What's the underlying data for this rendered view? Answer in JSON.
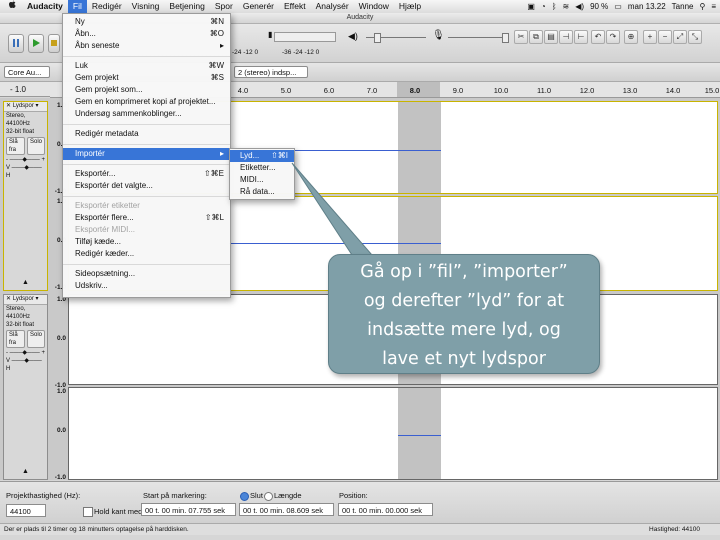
{
  "menubar": {
    "app_name": "Audacity",
    "items": [
      "Fil",
      "Redigér",
      "Visning",
      "Betjening",
      "Spor",
      "Generér",
      "Effekt",
      "Analysér",
      "Window",
      "Hjælp"
    ],
    "battery": "90 %",
    "clock": "man 13.22",
    "user": "Tanne"
  },
  "window": {
    "title": "Audacity"
  },
  "toolbar": {
    "meter_ticks": [
      "-24",
      "-12",
      "0",
      "-36",
      "-24",
      "-12",
      "0"
    ]
  },
  "devices": {
    "host": "Core Au...",
    "channels": "2 (stereo) indsp..."
  },
  "ruler": {
    "left_label": "- 1.0",
    "ticks": [
      "4.0",
      "5.0",
      "6.0",
      "7.0",
      "8.0",
      "9.0",
      "10.0",
      "11.0",
      "12.0",
      "13.0",
      "14.0",
      "15.0"
    ]
  },
  "tracks": [
    {
      "name": "Lydspor",
      "info1": "Stereo, 44100Hz",
      "info2": "32-bit float",
      "mute": "Slå fra",
      "solo": "Solo",
      "gain_minus": "-",
      "gain_plus": "+",
      "pan_left": "V",
      "pan_right": "H",
      "scale_top": [
        "1.0",
        "0.0",
        "-1.0"
      ],
      "scale_bottom": [
        "1.0",
        "0.0",
        "-1.0"
      ]
    },
    {
      "name": "Lydspor",
      "info1": "Stereo, 44100Hz",
      "info2": "32-bit float",
      "mute": "Slå fra",
      "solo": "Solo",
      "gain_minus": "-",
      "gain_plus": "+",
      "pan_left": "V",
      "pan_right": "H",
      "scale_top": [
        "1.0",
        "0.0",
        "-1.0"
      ],
      "scale_bottom": [
        "1.0",
        "0.0",
        "-1.0"
      ]
    }
  ],
  "file_menu": {
    "items": [
      {
        "label": "Ny",
        "shortcut": "⌘N"
      },
      {
        "label": "Åbn...",
        "shortcut": "⌘O"
      },
      {
        "label": "Åbn seneste",
        "shortcut": "▸"
      },
      {
        "label": "Luk",
        "shortcut": "⌘W"
      },
      {
        "label": "Gem projekt",
        "shortcut": "⌘S"
      },
      {
        "label": "Gem projekt som...",
        "shortcut": ""
      },
      {
        "label": "Gem en komprimeret kopi af projektet...",
        "shortcut": ""
      },
      {
        "label": "Undersøg sammenkoblinger...",
        "shortcut": ""
      },
      {
        "label": "Redigér metadata",
        "shortcut": ""
      },
      {
        "label": "Importér",
        "shortcut": "▸"
      },
      {
        "label": "Eksportér...",
        "shortcut": "⇧⌘E"
      },
      {
        "label": "Eksportér det valgte...",
        "shortcut": ""
      },
      {
        "label": "Eksportér etiketter",
        "shortcut": ""
      },
      {
        "label": "Eksportér flere...",
        "shortcut": "⇧⌘L"
      },
      {
        "label": "Eksportér MIDI...",
        "shortcut": ""
      },
      {
        "label": "Tilføj kæde...",
        "shortcut": ""
      },
      {
        "label": "Redigér kæder...",
        "shortcut": ""
      },
      {
        "label": "Sideopsætning...",
        "shortcut": ""
      },
      {
        "label": "Udskriv...",
        "shortcut": ""
      }
    ]
  },
  "import_submenu": {
    "items": [
      {
        "label": "Lyd...",
        "shortcut": "⇧⌘I"
      },
      {
        "label": "Etiketter...",
        "shortcut": ""
      },
      {
        "label": "MIDI...",
        "shortcut": ""
      },
      {
        "label": "Rå data...",
        "shortcut": ""
      }
    ]
  },
  "callout": {
    "lines": [
      "Gå op i ”fil”, ”importer”",
      "og derefter ”lyd” for at",
      "indsætte mere lyd, og",
      "lave et nyt lydspor"
    ]
  },
  "selection_bar": {
    "rate_label": "Projekthastighed (Hz):",
    "rate_value": "44100",
    "snap_label": "Hold kant med",
    "start_label": "Start på markering:",
    "end_radio": "Slut",
    "length_radio": "Længde",
    "position_label": "Position:",
    "start_value": "00 t. 00 min. 07.755 sek",
    "end_value": "00 t. 00 min. 08.609 sek",
    "position_value": "00 t. 00 min. 00.000 sek"
  },
  "status_bar": {
    "left": "Der er plads til 2 timer og 18 minutters optagelse på harddisken.",
    "right": "Hastighed: 44100"
  },
  "colors": {
    "menu_highlight": "#3875d7",
    "callout_fill": "#7f9fa8",
    "waveform": "#3a5fd0"
  }
}
